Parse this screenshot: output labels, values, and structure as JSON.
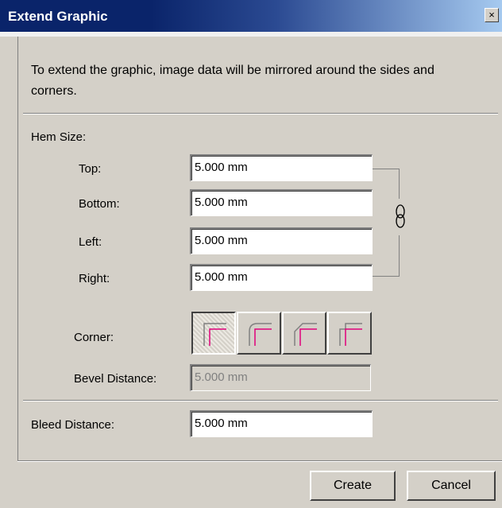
{
  "window": {
    "title": "Extend Graphic",
    "close_symbol": "×"
  },
  "description": "To extend the graphic, image data will be mirrored around the sides and corners.",
  "hem": {
    "section_label": "Hem Size:",
    "top_label": "Top:",
    "top_value": "5.000 mm",
    "bottom_label": "Bottom:",
    "bottom_value": "5.000 mm",
    "left_label": "Left:",
    "left_value": "5.000 mm",
    "right_label": "Right:",
    "right_value": "5.000 mm"
  },
  "corner": {
    "label": "Corner:",
    "options": [
      "square-corner-icon",
      "round-corner-icon",
      "bevel-corner-icon",
      "cross-corner-icon"
    ],
    "selected_index": 0
  },
  "bevel": {
    "label": "Bevel Distance:",
    "value": "5.000 mm",
    "disabled": true
  },
  "bleed": {
    "label": "Bleed Distance:",
    "value": "5.000 mm"
  },
  "buttons": {
    "create": "Create",
    "cancel": "Cancel"
  },
  "colors": {
    "accent_line": "#e0007a",
    "dialog_bg": "#d4d0c8",
    "title_bar": "#0a246a"
  }
}
